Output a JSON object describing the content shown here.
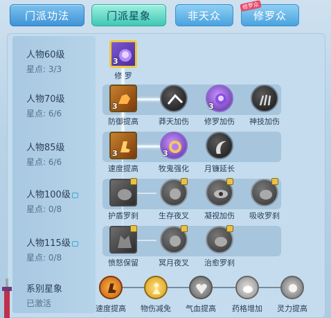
{
  "tabs": [
    {
      "label": "门派功法",
      "state": "normal"
    },
    {
      "label": "门派星象",
      "state": "active"
    },
    {
      "label": "非天众",
      "state": "normal"
    },
    {
      "label": "修罗众",
      "state": "normal",
      "badge": "修罗众"
    }
  ],
  "levels": [
    {
      "label": "人物60级",
      "stars": "星点: 3/3",
      "locked": false
    },
    {
      "label": "人物70级",
      "stars": "星点: 6/6",
      "locked": false
    },
    {
      "label": "人物85级",
      "stars": "星点: 6/6",
      "locked": false
    },
    {
      "label": "人物100级",
      "stars": "星点: 0/8",
      "locked": true
    },
    {
      "label": "人物115级",
      "stars": "星点: 0/8",
      "locked": true
    }
  ],
  "nodes": {
    "row1": [
      {
        "label": "修 罗",
        "count": "3",
        "icon": "shura-purple-icon"
      }
    ],
    "row2": [
      {
        "label": "防御提高",
        "count": "3",
        "icon": "muscle-arm-icon"
      },
      {
        "label": "莽天加伤",
        "icon": "impact-icon"
      },
      {
        "label": "修罗加伤",
        "count": "3",
        "icon": "shura-purple-icon"
      },
      {
        "label": "神技加伤",
        "icon": "claw-icon"
      }
    ],
    "row3": [
      {
        "label": "速度提高",
        "count": "3",
        "icon": "speed-boot-icon"
      },
      {
        "label": "牧鬼强化",
        "count": "3",
        "icon": "purple-burst-icon"
      },
      {
        "label": "月镰延长",
        "icon": "scythe-icon"
      }
    ],
    "row4": [
      {
        "label": "护盾罗刹",
        "icon": "shield-beast-icon"
      },
      {
        "label": "生存夜叉",
        "icon": "yaksha-icon"
      },
      {
        "label": "凝视加伤",
        "icon": "gaze-icon"
      },
      {
        "label": "吸收罗刹",
        "icon": "absorb-icon"
      }
    ],
    "row5": [
      {
        "label": "愤怒保留",
        "icon": "rage-demon-icon"
      },
      {
        "label": "冥月夜叉",
        "icon": "moon-yaksha-icon"
      },
      {
        "label": "治愈罗刹",
        "icon": "heal-rakshasa-icon"
      }
    ]
  },
  "system": {
    "title": "系别星象",
    "status": "已激活",
    "items": [
      {
        "label": "速度提高",
        "icon": "speed-boot-icon"
      },
      {
        "label": "物伤减免",
        "icon": "golden-figure-icon"
      },
      {
        "label": "气血提高",
        "icon": "heart-shield-icon"
      },
      {
        "label": "药格增加",
        "icon": "potion-icon"
      },
      {
        "label": "灵力提高",
        "icon": "spirit-icon"
      }
    ]
  },
  "colors": {
    "active_tab": "#3fc8b4",
    "tab_blue": "#3f93d6",
    "panel": "#c4dcee",
    "glow": "#eef8ff"
  }
}
